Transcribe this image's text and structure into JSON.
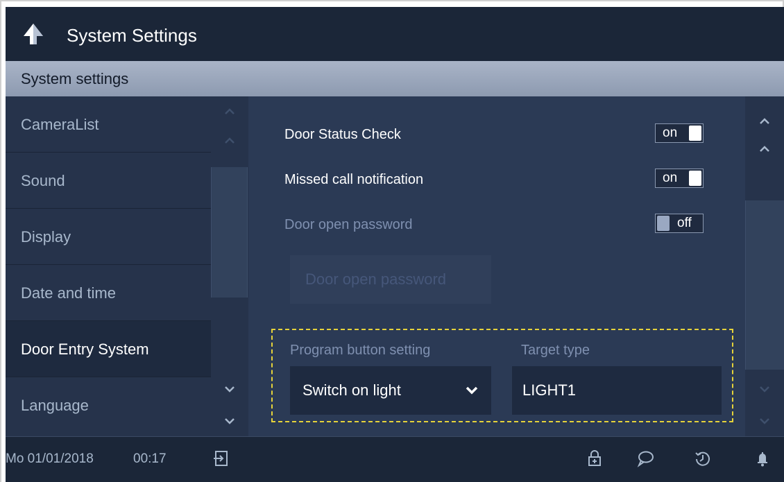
{
  "header": {
    "title": "System Settings",
    "back_icon": "back-arrow-icon"
  },
  "subheader": {
    "title": "System settings"
  },
  "sidebar": {
    "items": [
      {
        "label": "CameraList",
        "active": false
      },
      {
        "label": "Sound",
        "active": false
      },
      {
        "label": "Display",
        "active": false
      },
      {
        "label": "Date and time",
        "active": false
      },
      {
        "label": "Door Entry System",
        "active": true
      },
      {
        "label": "Language",
        "active": false
      }
    ]
  },
  "settings": {
    "door_status_check": {
      "label": "Door Status Check",
      "state": "on"
    },
    "missed_call": {
      "label": "Missed call notification",
      "state": "on"
    },
    "door_open_password": {
      "label": "Door open password",
      "state": "off"
    },
    "door_open_password_button": "Door open password"
  },
  "program": {
    "button_setting_label": "Program button setting",
    "button_setting_value": "Switch on light",
    "target_type_label": "Target type",
    "target_type_value": "LIGHT1"
  },
  "status": {
    "date": "Mo 01/01/2018",
    "time": "00:17",
    "icons": [
      "exit-icon",
      "lock-icon",
      "message-icon",
      "history-icon",
      "bell-icon"
    ]
  },
  "colors": {
    "highlight_border": "#e6d33a",
    "background": "#26334b",
    "title_bar": "#1b2638"
  }
}
